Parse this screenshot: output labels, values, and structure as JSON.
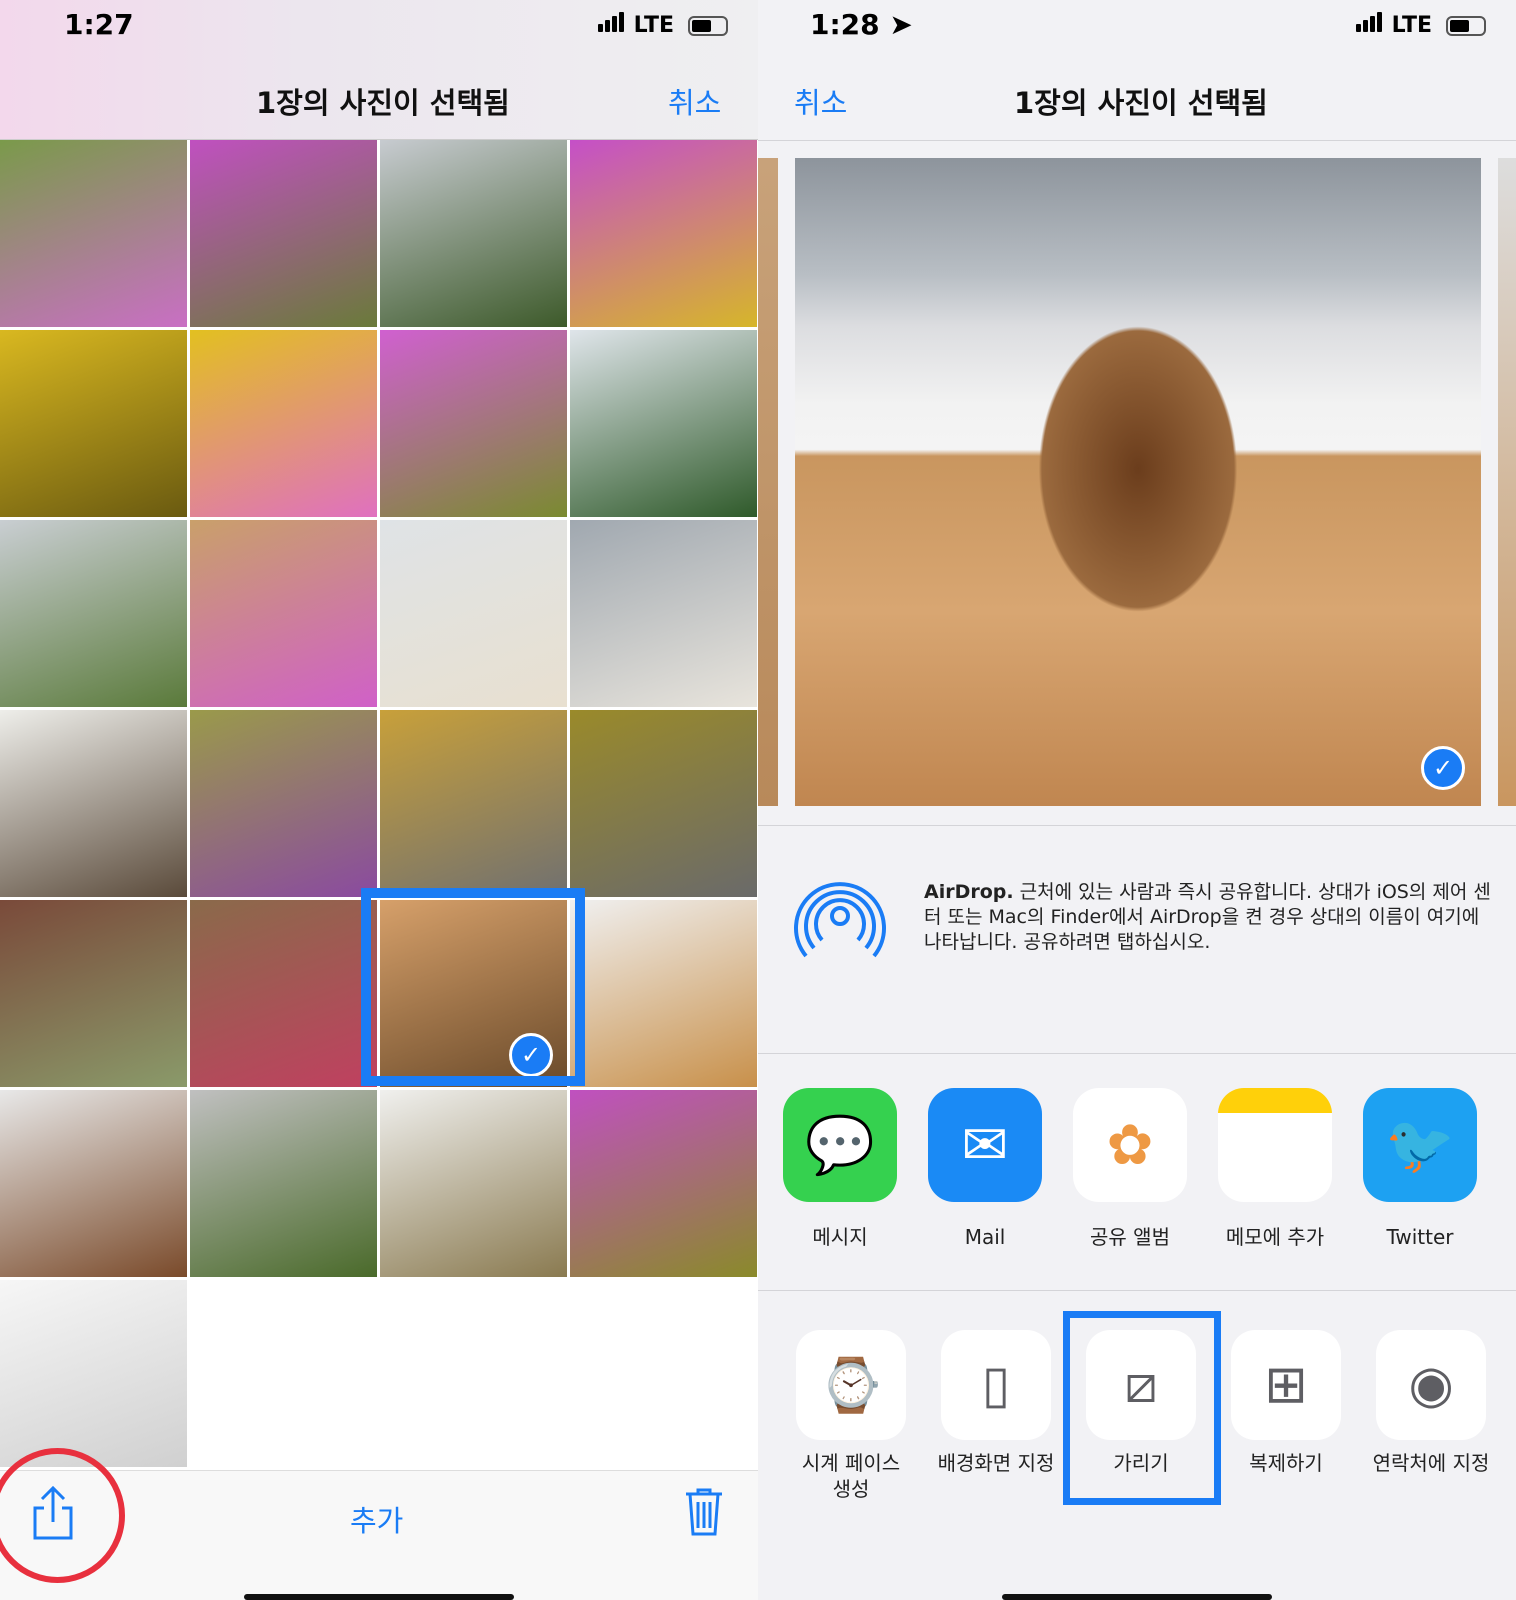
{
  "left": {
    "status": {
      "time": "1:27",
      "network": "LTE"
    },
    "nav": {
      "title": "1장의 사진이 선택됨",
      "cancel": "취소"
    },
    "grid": {
      "photo_count": 25,
      "selected_index": 18
    },
    "toolbar": {
      "add": "추가"
    },
    "highlight_color": "#1a7cf5",
    "circle_color": "#e8303e"
  },
  "right": {
    "status": {
      "time": "1:28",
      "network": "LTE"
    },
    "nav": {
      "cancel": "취소",
      "title": "1장의 사진이 선택됨"
    },
    "airdrop": {
      "bold": "AirDrop.",
      "text": " 근처에 있는 사람과 즉시 공유합니다. 상대가 iOS의 제어 센터 또는 Mac의 Finder에서 AirDrop을 켠 경우 상대의 이름이 여기에 나타납니다. 공유하려면 탭하십시오."
    },
    "apps": [
      {
        "label": "메시지",
        "icon": "messages-icon"
      },
      {
        "label": "Mail",
        "icon": "mail-icon"
      },
      {
        "label": "공유 앨범",
        "icon": "photos-icon"
      },
      {
        "label": "메모에 추가",
        "icon": "notes-icon"
      },
      {
        "label": "Twitter",
        "icon": "twitter-icon"
      }
    ],
    "actions": [
      {
        "label": "시계 페이스\n생성",
        "icon": "watch-icon"
      },
      {
        "label": "배경화면 지정",
        "icon": "phone-icon"
      },
      {
        "label": "가리기",
        "icon": "hide-icon",
        "highlighted": true
      },
      {
        "label": "복제하기",
        "icon": "duplicate-icon"
      },
      {
        "label": "연락처에 지정",
        "icon": "contact-icon"
      }
    ]
  }
}
